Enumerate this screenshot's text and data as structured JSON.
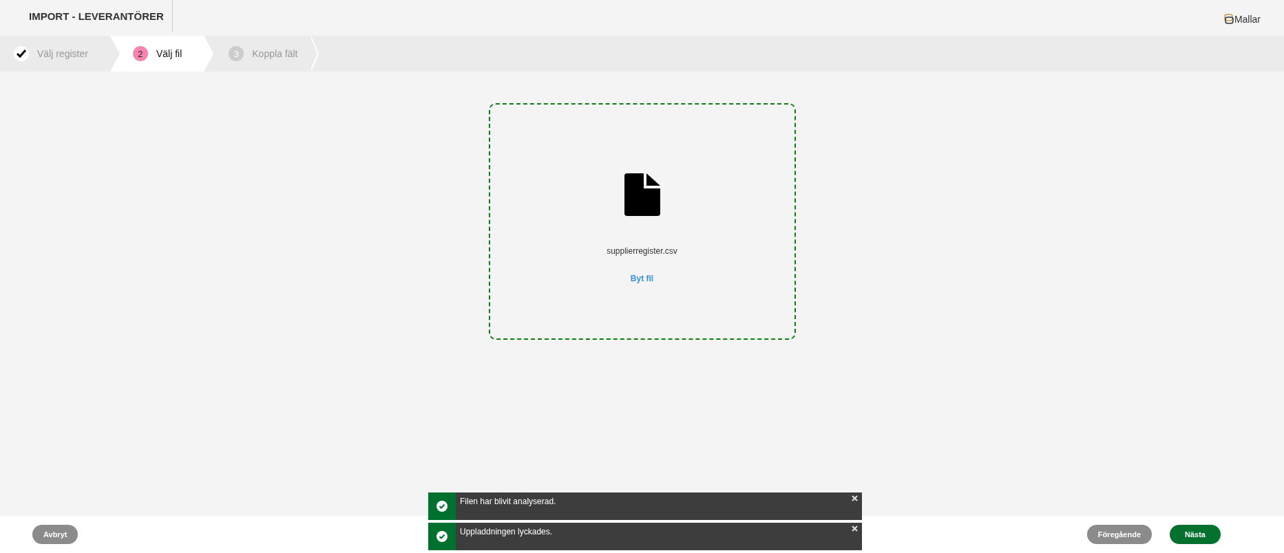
{
  "header": {
    "title": "IMPORT - LEVERANTÖRER",
    "templates_link": "Mallar"
  },
  "steps": [
    {
      "label": "Välj register",
      "done": true,
      "selected": false
    },
    {
      "number": "2",
      "label": "Välj fil",
      "done": false,
      "selected": true
    },
    {
      "number": "3",
      "label": "Koppla fält",
      "done": false,
      "selected": false
    }
  ],
  "dropzone": {
    "filename": "supplierregister.csv",
    "change_link": "Byt fil"
  },
  "toasts": [
    {
      "message": "Filen har blivit analyserad."
    },
    {
      "message": "Uppladdningen lyckades."
    }
  ],
  "footer": {
    "cancel": "Avbryt",
    "previous": "Föregående",
    "next": "Nästa"
  }
}
